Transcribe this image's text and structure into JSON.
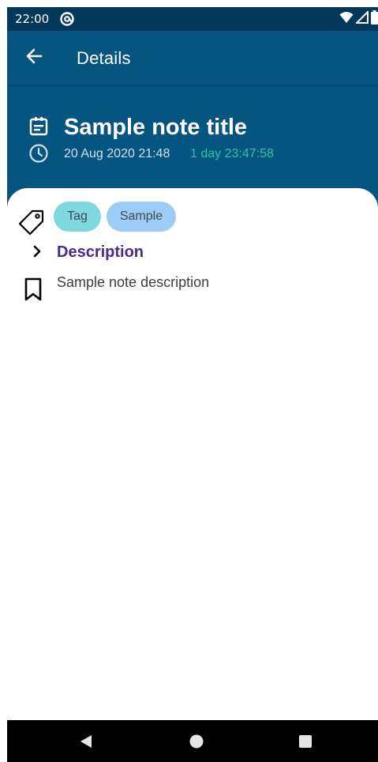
{
  "status_bar": {
    "time": "22:00",
    "icons": [
      "at-sign-icon",
      "wifi-icon",
      "signal-icon",
      "battery-icon"
    ]
  },
  "app_bar": {
    "title": "Details",
    "back_icon": "arrow-left-icon"
  },
  "note": {
    "title": "Sample note title",
    "date": "20 Aug 2020 21:48",
    "elapsed": "1 day 23:47:58"
  },
  "tags": [
    {
      "label": "Tag",
      "color": "#7fd8de"
    },
    {
      "label": "Sample",
      "color": "#9cccf5"
    }
  ],
  "description_section": {
    "title": "Description",
    "text": "Sample note description"
  },
  "colors": {
    "primary_dark": "#04385a",
    "primary": "#055580",
    "accent_elapsed": "#2ec4a0",
    "section_title": "#4a2a8e"
  },
  "nav_bar": {
    "icons": [
      "back-triangle-icon",
      "home-circle-icon",
      "recents-square-icon"
    ]
  }
}
